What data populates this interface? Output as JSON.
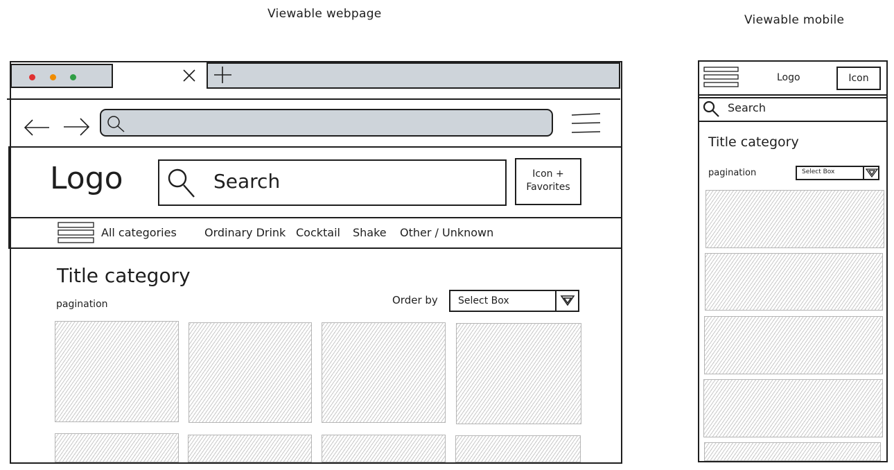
{
  "captions": {
    "webpage": "Viewable webpage",
    "mobile": "Viewable mobile"
  },
  "colors": {
    "stroke": "#1e1e1e",
    "chrome_fill": "#ced4da",
    "hatch": "#c8c8c8",
    "dot_red": "#e03131",
    "dot_orange": "#f08c00",
    "dot_green": "#2f9e44"
  },
  "icons": [
    "close-icon",
    "plus-icon",
    "back-arrow-icon",
    "forward-arrow-icon",
    "search-icon",
    "hamburger-menu-icon",
    "dropdown-arrow-icon"
  ],
  "desktop": {
    "logo": "Logo",
    "search_placeholder": "Search",
    "favorites_button": {
      "line1": "Icon +",
      "line2": "Favorites"
    },
    "nav": {
      "all_categories": "All categories",
      "items": [
        "Ordinary Drink",
        "Cocktail",
        "Shake",
        "Other / Unknown"
      ]
    },
    "title": "Title category",
    "pagination": "pagination",
    "order_by_label": "Order by",
    "select_box": "Select Box"
  },
  "mobile": {
    "logo": "Logo",
    "icon_button": "Icon",
    "search_placeholder": "Search",
    "title": "Title category",
    "pagination": "pagination",
    "select_box": "Select Box"
  }
}
